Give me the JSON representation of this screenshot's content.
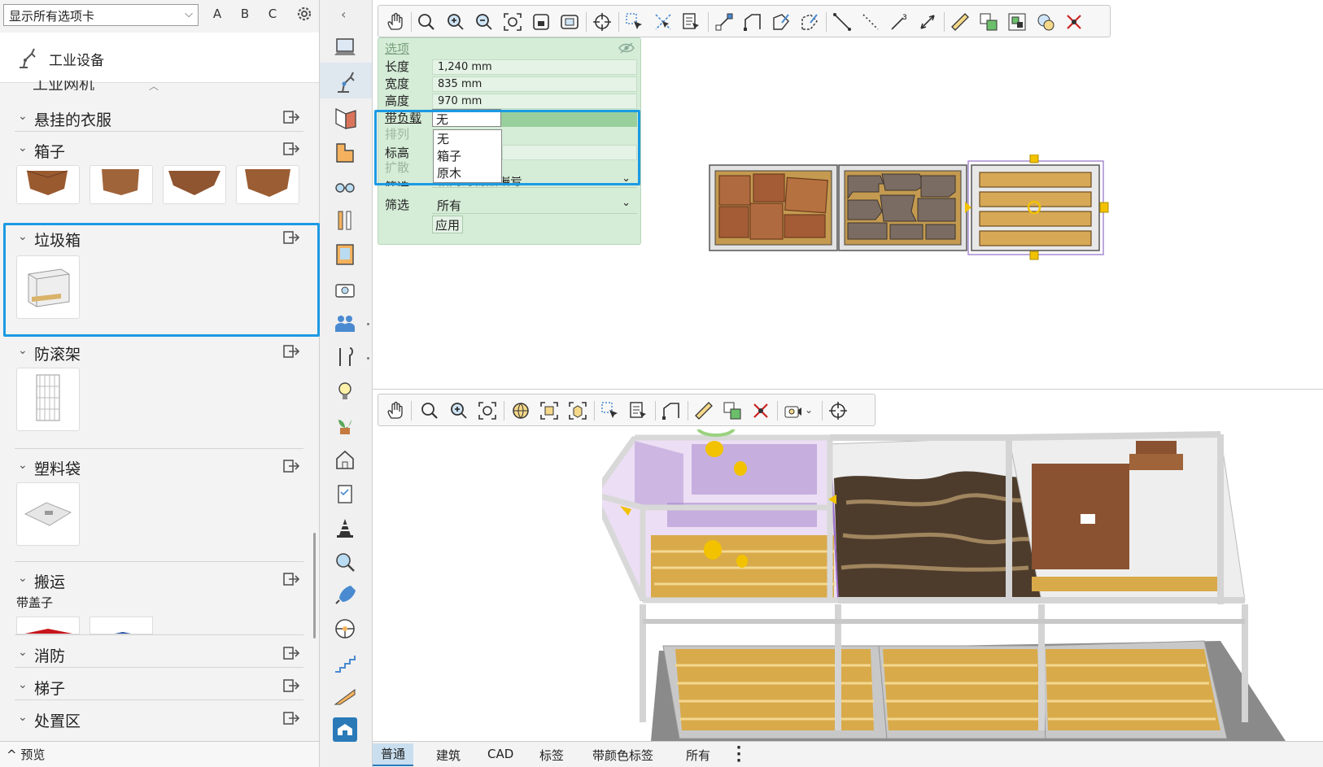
{
  "left_panel": {
    "tab_select": "显示所有选项卡",
    "letter_buttons": [
      "A",
      "B",
      "C"
    ],
    "category_title": "工业设备",
    "partial_section": "工业网机",
    "sections": [
      {
        "label": "悬挂的衣服"
      },
      {
        "label": "箱子"
      },
      {
        "label": "垃圾箱"
      },
      {
        "label": "防滚架"
      },
      {
        "label": "塑料袋"
      },
      {
        "label": "搬运"
      },
      {
        "label": "消防"
      },
      {
        "label": "梯子"
      },
      {
        "label": "处置区"
      }
    ],
    "carry_subtitle": "带盖子",
    "preview_label": "预览"
  },
  "options_panel": {
    "title": "选项",
    "rows": [
      {
        "label": "长度",
        "value": "1,240 mm"
      },
      {
        "label": "宽度",
        "value": "835 mm"
      },
      {
        "label": "高度",
        "value": "970 mm"
      }
    ],
    "load_label": "带负载",
    "load_value": "无",
    "arrange_label": "排列",
    "elevation_label": "标高",
    "spread_label": "扩散",
    "filter1_label": "筛选",
    "filter1_value": "相同的物品编号",
    "filter2_label": "筛选",
    "filter2_value": "所有",
    "apply_label": "应用"
  },
  "load_dropdown": {
    "options": [
      "无",
      "箱子",
      "原木"
    ]
  },
  "bottom_tabs": [
    "普通",
    "建筑",
    "CAD",
    "标签",
    "带颜色标签",
    "所有"
  ],
  "colors": {
    "accent_blue": "#1b9ae3",
    "options_bg": "#d5ecd7",
    "selection_purple": "#a78bd0",
    "handle_yellow": "#f2c200"
  }
}
